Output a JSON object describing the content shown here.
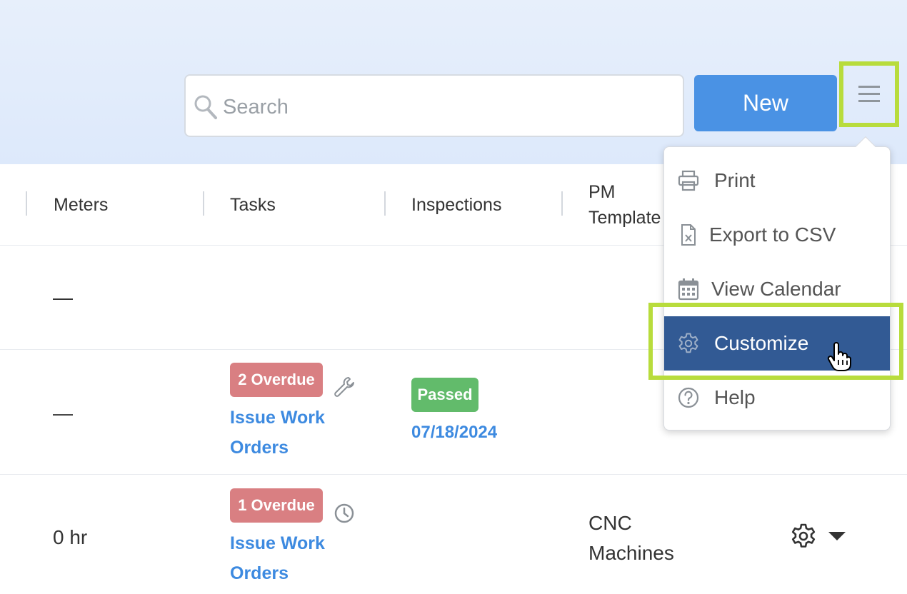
{
  "header": {
    "search": {
      "placeholder": "Search",
      "value": ""
    },
    "new_button_label": "New",
    "menu_icon": "hamburger-icon"
  },
  "table": {
    "columns": [
      "Meters",
      "Tasks",
      "Inspections",
      "PM\nTemplate"
    ],
    "rows": [
      {
        "meters": "—"
      },
      {
        "meters": "—",
        "tasks_badge": "2 Overdue",
        "tasks_link_line1": "Issue Work",
        "tasks_link_line2": "Orders",
        "tasks_icon": "wrench-icon",
        "inspection_badge": "Passed",
        "inspection_date": "07/18/2024"
      },
      {
        "meters": "0 hr",
        "tasks_badge": "1 Overdue",
        "tasks_link_line1": "Issue Work",
        "tasks_link_line2": "Orders",
        "tasks_icon": "clock-icon",
        "pm_template_line1": "CNC",
        "pm_template_line2": "Machines",
        "action_icon": "gear-icon"
      }
    ]
  },
  "dropdown": {
    "items": [
      {
        "label": "Print",
        "icon": "printer-icon"
      },
      {
        "label": "Export to CSV",
        "icon": "csv-file-icon"
      },
      {
        "label": "View Calendar",
        "icon": "calendar-icon"
      },
      {
        "label": "Customize",
        "icon": "gear-icon",
        "active": true
      },
      {
        "label": "Help",
        "icon": "help-icon"
      }
    ]
  },
  "colors": {
    "accent": "#4a92e4",
    "active_menu": "#325a94",
    "overdue": "#d97f82",
    "passed": "#62bb6b",
    "link": "#3d8ae0",
    "highlight": "#b8dc3c"
  }
}
